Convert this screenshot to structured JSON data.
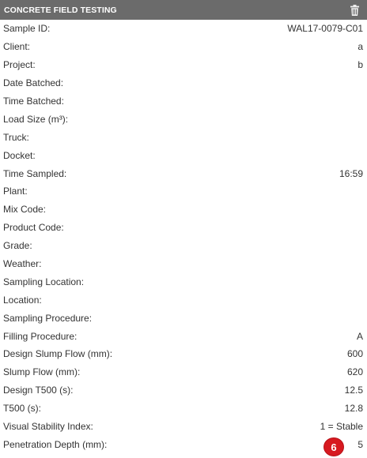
{
  "header": {
    "title": "CONCRETE FIELD TESTING",
    "delete_icon": "trash-icon"
  },
  "fields": [
    {
      "label": "Sample ID:",
      "value": "WAL17-0079-C01"
    },
    {
      "label": "Client:",
      "value": "a"
    },
    {
      "label": "Project:",
      "value": "b"
    },
    {
      "label": "Date Batched:",
      "value": ""
    },
    {
      "label": "Time Batched:",
      "value": ""
    },
    {
      "label": "Load Size (m³):",
      "value": ""
    },
    {
      "label": "Truck:",
      "value": ""
    },
    {
      "label": "Docket:",
      "value": ""
    },
    {
      "label": "Time Sampled:",
      "value": "16:59"
    },
    {
      "label": "Plant:",
      "value": ""
    },
    {
      "label": "Mix Code:",
      "value": ""
    },
    {
      "label": "Product Code:",
      "value": ""
    },
    {
      "label": "Grade:",
      "value": ""
    },
    {
      "label": "Weather:",
      "value": ""
    },
    {
      "label": "Sampling Location:",
      "value": ""
    },
    {
      "label": "Location:",
      "value": ""
    },
    {
      "label": "Sampling Procedure:",
      "value": ""
    },
    {
      "label": "Filling Procedure:",
      "value": "A"
    },
    {
      "label": "Design Slump Flow (mm):",
      "value": "600"
    },
    {
      "label": "Slump Flow (mm):",
      "value": "620"
    },
    {
      "label": "Design T500 (s):",
      "value": "12.5"
    },
    {
      "label": "T500 (s):",
      "value": "12.8"
    },
    {
      "label": "Visual Stability Index:",
      "value": "1 = Stable"
    },
    {
      "label": "Penetration Depth (mm):",
      "value": "5"
    }
  ],
  "badge": {
    "count": "6"
  },
  "colors": {
    "header_bg": "#6b6b6b",
    "badge_bg": "#d71920"
  }
}
